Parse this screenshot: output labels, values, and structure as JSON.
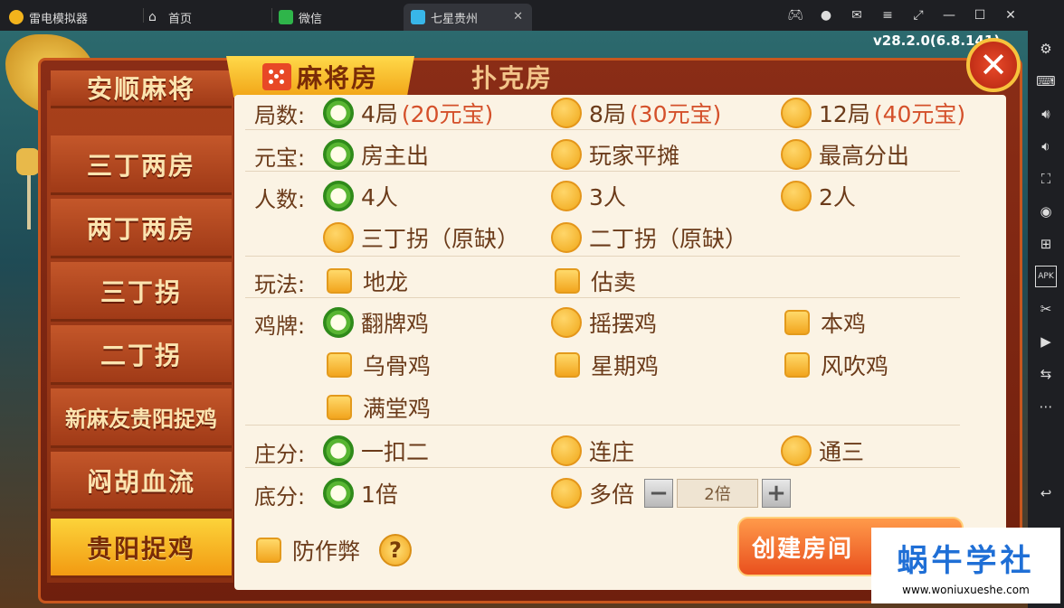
{
  "titlebar": {
    "app_name": "雷电模拟器",
    "tabs": [
      {
        "label": "首页",
        "icon": "home-icon"
      },
      {
        "label": "微信",
        "icon": "wechat-icon"
      },
      {
        "label": "七星贵州",
        "icon": "game-icon",
        "active": true
      }
    ],
    "controls": [
      "gamepad-icon",
      "account-icon",
      "mail-icon",
      "menu-icon",
      "restore-icon",
      "minimize-icon",
      "maximize-icon",
      "close-icon"
    ]
  },
  "sidebar": {
    "buttons": [
      "settings-icon",
      "keyboard-icon",
      "volume-up-icon",
      "volume-down-icon",
      "screenshot-icon",
      "record-icon",
      "add-icon",
      "apk-icon",
      "scissors-icon",
      "play-icon",
      "sync-icon",
      "more-icon",
      "back-icon"
    ]
  },
  "game": {
    "version": "v28.2.0(6.8.141)",
    "tabs": {
      "mahjong": "麻将房",
      "poker": "扑克房"
    },
    "menu": [
      {
        "label": "安顺麻将"
      },
      {
        "label": "三丁两房"
      },
      {
        "label": "两丁两房"
      },
      {
        "label": "三丁拐"
      },
      {
        "label": "二丁拐"
      },
      {
        "label": "新麻友贵阳捉鸡"
      },
      {
        "label": "闷胡血流"
      },
      {
        "label": "贵阳捉鸡",
        "selected": true
      }
    ],
    "options": {
      "rounds": {
        "label": "局数:",
        "items": [
          {
            "text": "4局",
            "extra": "(20元宝)",
            "selected": true
          },
          {
            "text": "8局",
            "extra": "(30元宝)"
          },
          {
            "text": "12局",
            "extra": "(40元宝)"
          }
        ]
      },
      "yuanbao": {
        "label": "元宝:",
        "items": [
          {
            "text": "房主出",
            "selected": true
          },
          {
            "text": "玩家平摊"
          },
          {
            "text": "最高分出"
          }
        ]
      },
      "players": {
        "label": "人数:",
        "items": [
          {
            "text": "4人",
            "selected": true
          },
          {
            "text": "3人"
          },
          {
            "text": "2人"
          },
          {
            "text": "三丁拐（原缺）"
          },
          {
            "text": "二丁拐（原缺）"
          }
        ]
      },
      "play": {
        "label": "玩法:",
        "items": [
          {
            "text": "地龙"
          },
          {
            "text": "估卖"
          }
        ]
      },
      "chicken": {
        "label": "鸡牌:",
        "items": [
          {
            "text": "翻牌鸡",
            "selected": true
          },
          {
            "text": "摇摆鸡"
          },
          {
            "text": "本鸡"
          },
          {
            "text": "乌骨鸡"
          },
          {
            "text": "星期鸡"
          },
          {
            "text": "风吹鸡"
          },
          {
            "text": "满堂鸡"
          }
        ]
      },
      "banker": {
        "label": "庄分:",
        "items": [
          {
            "text": "一扣二",
            "selected": true
          },
          {
            "text": "连庄"
          },
          {
            "text": "通三"
          }
        ]
      },
      "base": {
        "label": "底分:",
        "items": [
          {
            "text": "1倍",
            "selected": true
          },
          {
            "text": "多倍"
          }
        ],
        "stepper_value": "2倍"
      }
    },
    "anticheat": "防作弊",
    "help": "?",
    "create_button": "创建房间"
  },
  "watermark": {
    "title": "蜗牛学社",
    "url": "www.woniuxueshe.com"
  }
}
